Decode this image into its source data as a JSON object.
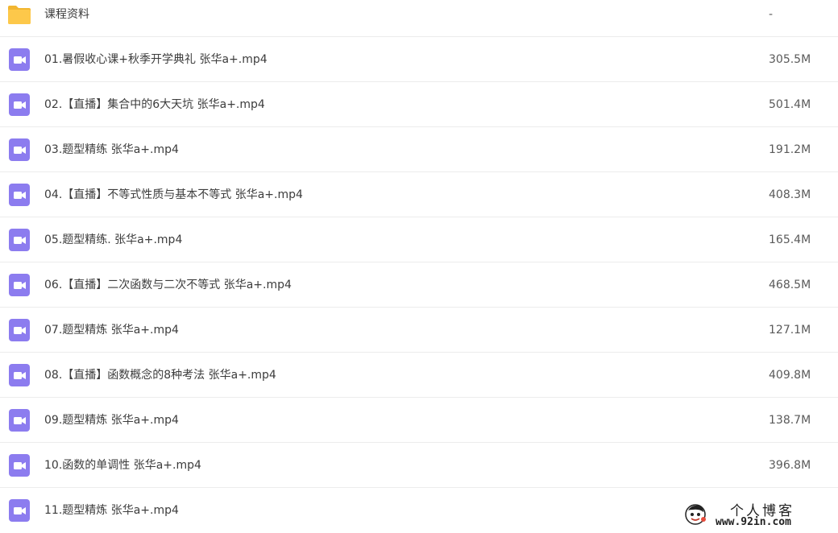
{
  "colors": {
    "folder": "#FDC84A",
    "video": "#8C7CEF"
  },
  "rows": [
    {
      "icon": "folder-icon",
      "name": "课程资料",
      "size": "-"
    },
    {
      "icon": "video-file-icon",
      "name": "01.暑假收心课+秋季开学典礼 张华a+.mp4",
      "size": "305.5M"
    },
    {
      "icon": "video-file-icon",
      "name": "02.【直播】集合中的6大天坑 张华a+.mp4",
      "size": "501.4M"
    },
    {
      "icon": "video-file-icon",
      "name": "03.题型精练 张华a+.mp4",
      "size": "191.2M"
    },
    {
      "icon": "video-file-icon",
      "name": "04.【直播】不等式性质与基本不等式 张华a+.mp4",
      "size": "408.3M"
    },
    {
      "icon": "video-file-icon",
      "name": "05.题型精练. 张华a+.mp4",
      "size": "165.4M"
    },
    {
      "icon": "video-file-icon",
      "name": "06.【直播】二次函数与二次不等式 张华a+.mp4",
      "size": "468.5M"
    },
    {
      "icon": "video-file-icon",
      "name": "07.题型精炼 张华a+.mp4",
      "size": "127.1M"
    },
    {
      "icon": "video-file-icon",
      "name": "08.【直播】函数概念的8种考法 张华a+.mp4",
      "size": "409.8M"
    },
    {
      "icon": "video-file-icon",
      "name": "09.题型精炼 张华a+.mp4",
      "size": "138.7M"
    },
    {
      "icon": "video-file-icon",
      "name": "10.函数的单调性 张华a+.mp4",
      "size": "396.8M"
    },
    {
      "icon": "video-file-icon",
      "name": "11.题型精炼 张华a+.mp4",
      "size": ""
    }
  ],
  "watermark": {
    "title": "个人博客",
    "url": "www.92in.com"
  }
}
